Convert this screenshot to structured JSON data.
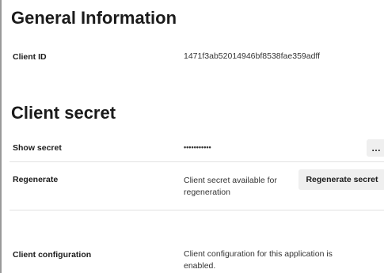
{
  "general": {
    "title": "General Information",
    "client_id_label": "Client ID",
    "client_id_value": "1471f3ab52014946bf8538fae359adff"
  },
  "client_secret": {
    "title": "Client secret",
    "show_secret_label": "Show secret",
    "secret_masked": "•••••••••••",
    "more_button_label": "…",
    "regenerate_label": "Regenerate",
    "regenerate_status": "Client secret available for regeneration",
    "regenerate_button_label": "Regenerate secret",
    "client_configuration_label": "Client configuration",
    "client_configuration_status": "Client configuration for this application is enabled."
  },
  "icons": {
    "more": "more-horizontal-icon"
  }
}
